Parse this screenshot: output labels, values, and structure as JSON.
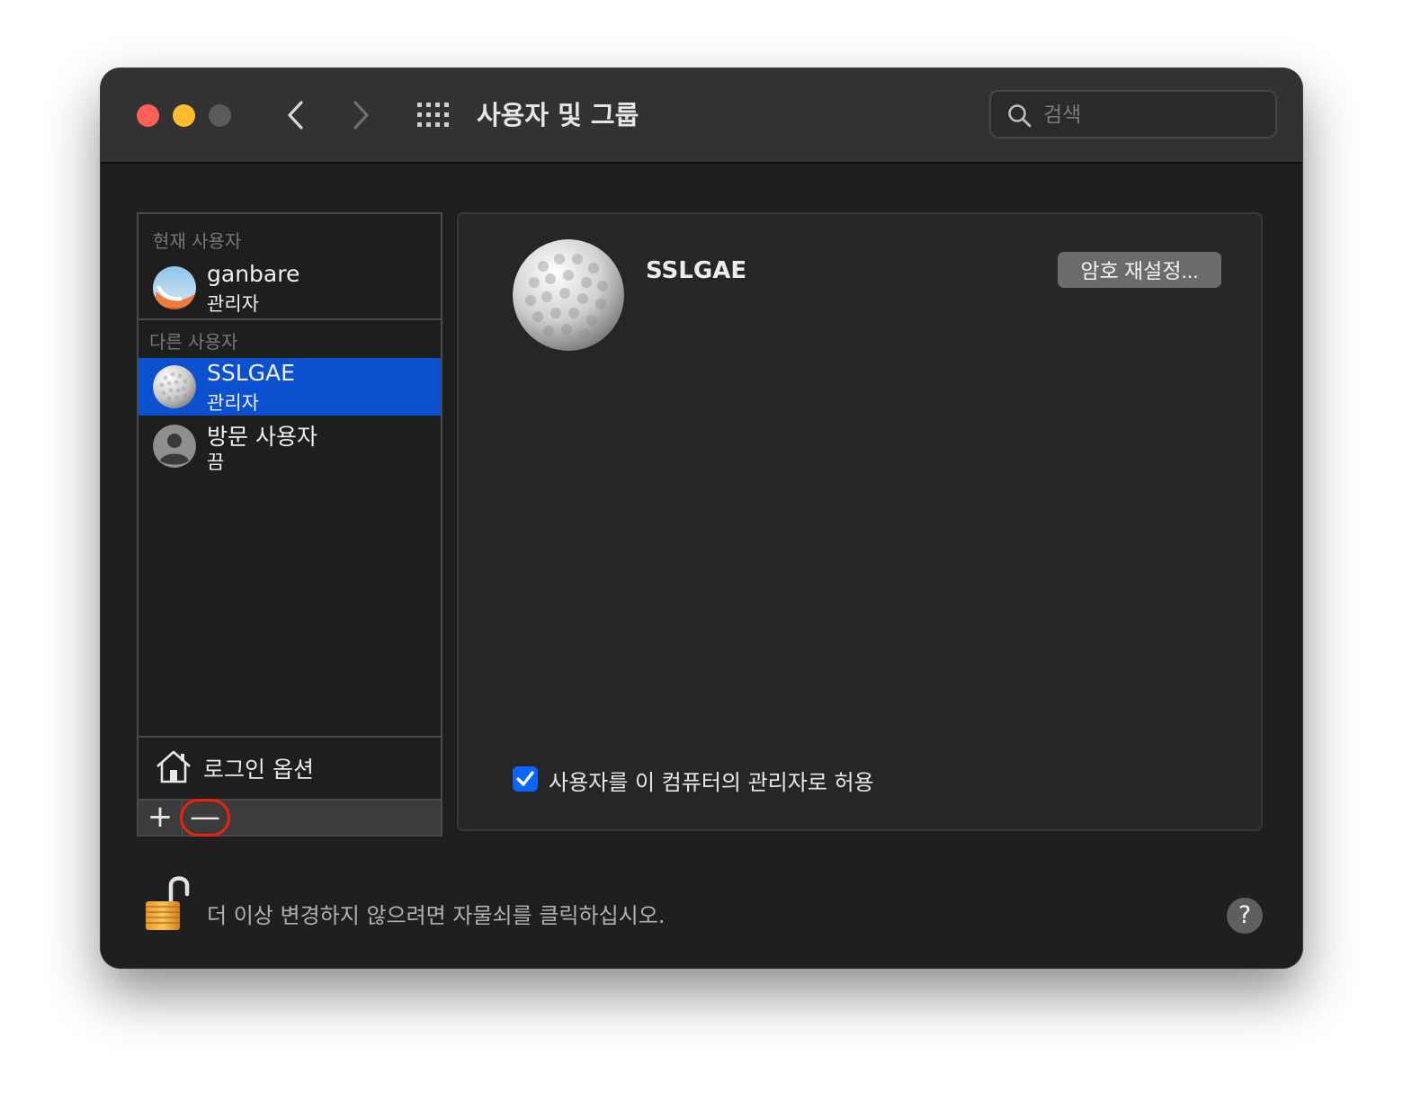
{
  "window": {
    "title": "사용자 및 그룹",
    "search_placeholder": "검색"
  },
  "sidebar": {
    "current_header": "현재 사용자",
    "other_header": "다른 사용자",
    "users": [
      {
        "name": "ganbare",
        "role": "관리자",
        "selected": false
      },
      {
        "name": "SSLGAE",
        "role": "관리자",
        "selected": true
      },
      {
        "name": "방문 사용자",
        "role": "끔",
        "selected": false
      }
    ],
    "login_options": "로그인 옵션",
    "add_label": "+",
    "remove_label": "—"
  },
  "panel": {
    "username": "SSLGAE",
    "reset_password": "암호 재설정...",
    "allow_admin": "사용자를 이 컴퓨터의 관리자로 허용",
    "allow_admin_checked": true
  },
  "footer": {
    "lock_text": "더 이상 변경하지 않으려면 자물쇠를 클릭하십시오.",
    "help": "?"
  },
  "colors": {
    "selection": "#0a50cf",
    "highlight_ring": "#f21e0e",
    "checkbox": "#0a64ff"
  }
}
